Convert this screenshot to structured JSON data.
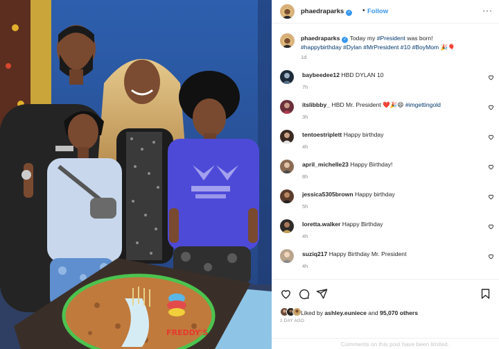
{
  "post": {
    "username": "phaedraparks",
    "separator": "•",
    "follow_label": "Follow",
    "more_label": "···",
    "caption": {
      "username": "phaedraparks",
      "text_before": "Today my ",
      "tag1": "#President",
      "text_after": " was born!",
      "tags_line2": "#happybirthday #Dylan #MrPresident #10 #BoyMom",
      "emoji": "🎉🎈",
      "time": "1d"
    },
    "comments": [
      {
        "user": "baybeedee12",
        "text": "HBD DYLAN 10",
        "time": "7h"
      },
      {
        "user": "itslibbby_",
        "text": "HBD Mr. President ❤️🎉😄 ",
        "tag": "#imgettingold",
        "time": "3h"
      },
      {
        "user": "tentoestriplett",
        "text": "Happy birthday",
        "time": "4h"
      },
      {
        "user": "april_michelle23",
        "text": "Happy Birthday!",
        "time": "8h"
      },
      {
        "user": "jessica5305brown",
        "text": "Happy birthday",
        "time": "5h"
      },
      {
        "user": "loretta.walker",
        "text": "Happy Birthday",
        "time": "4h"
      },
      {
        "user": "suziq217",
        "text": "Happy Birthday Mr. President",
        "time": "4h"
      }
    ],
    "likes": {
      "prefix": "Liked by ",
      "user": "ashley.euniece",
      "middle": " and ",
      "count": "95,070 others"
    },
    "date": "1 DAY AGO",
    "comments_limited": "Comments on this post have been limited."
  },
  "photo": {
    "cake_text": "FREDDY'S"
  },
  "colors": {
    "accent": "#3897f0",
    "hashtag": "#00376b",
    "muted": "#8e8e8e",
    "like_heart": "#ed4956"
  },
  "icons": [
    "verified-badge-icon",
    "more-options-icon",
    "heart-icon",
    "comment-icon",
    "share-icon",
    "bookmark-icon"
  ]
}
